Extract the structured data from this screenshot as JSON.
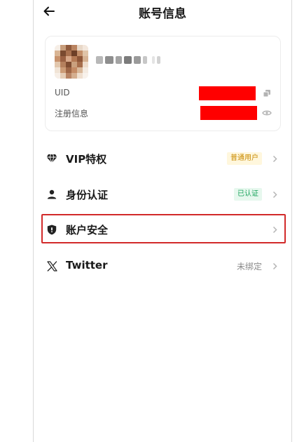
{
  "header": {
    "title": "账号信息",
    "back_icon": "arrow-left-icon"
  },
  "profile": {
    "info_rows": [
      {
        "label": "UID",
        "icon": "copy-icon"
      },
      {
        "label": "注册信息",
        "icon": "eye-icon"
      }
    ],
    "redaction_color": "#ff0000"
  },
  "menu": [
    {
      "id": "vip",
      "icon": "diamond-icon",
      "label": "VIP特权",
      "badge": "普通用户",
      "badge_style": "yellow"
    },
    {
      "id": "identity",
      "icon": "user-icon",
      "label": "身份认证",
      "badge": "已认证",
      "badge_style": "green"
    },
    {
      "id": "security",
      "icon": "shield-icon",
      "label": "账户安全",
      "badge": "",
      "badge_style": "",
      "highlighted": true
    },
    {
      "id": "twitter",
      "icon": "x-logo-icon",
      "label": "Twitter",
      "value": "未绑定"
    }
  ],
  "colors": {
    "highlight_border": "#d22a2a",
    "badge_yellow_text": "#c98a00",
    "badge_green_text": "#1aa35c"
  }
}
